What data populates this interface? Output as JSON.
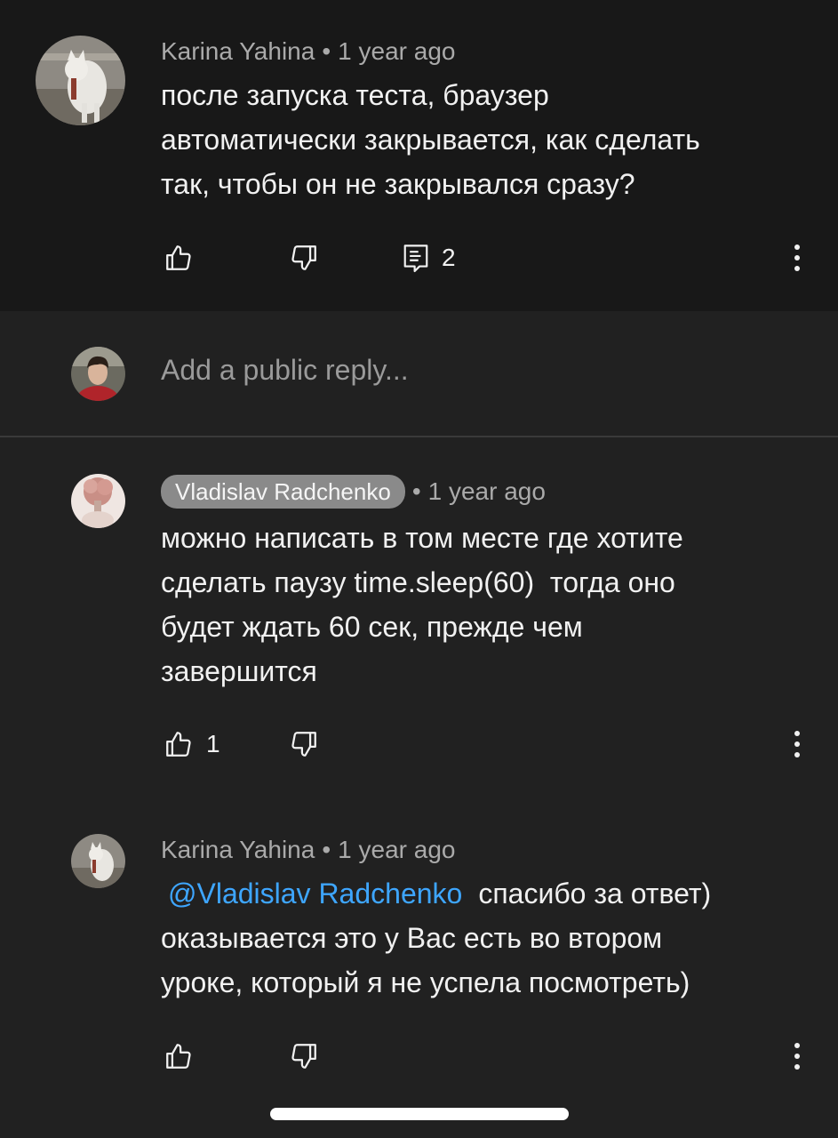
{
  "comment": {
    "author": "Karina Yahina",
    "time": "1 year ago",
    "text_lines": [
      "после запуска теста, браузер",
      "автоматически закрывается, как сделать",
      "так, чтобы он не закрывался сразу?"
    ],
    "reply_count": "2",
    "icons": {
      "like": "thumb-up-icon",
      "dislike": "thumb-down-icon",
      "replies": "comment-icon",
      "more": "more-vert-icon"
    }
  },
  "reply_box": {
    "placeholder": "Add a public reply..."
  },
  "replies": [
    {
      "author": "Vladislav Radchenko",
      "time": "1 year ago",
      "text_lines": [
        "можно написать в том месте где хотите",
        "сделать паузу time.sleep(60)  тогда оно",
        "будет ждать 60 сек, прежде чем",
        "завершится"
      ],
      "like_count": "1"
    },
    {
      "author": "Karina Yahina",
      "time": "1 year ago",
      "mention": "@Vladislav Radchenko",
      "first_line_rest": "спасибо за ответ)",
      "text_lines": [
        "оказывается это у Вас есть во втором",
        "уроке, который я не успела посмотреть)"
      ]
    }
  ],
  "colors": {
    "background": "#212121",
    "comment_background": "#181818",
    "meta_text": "#aaaaaa",
    "mention": "#3ea6ff"
  }
}
